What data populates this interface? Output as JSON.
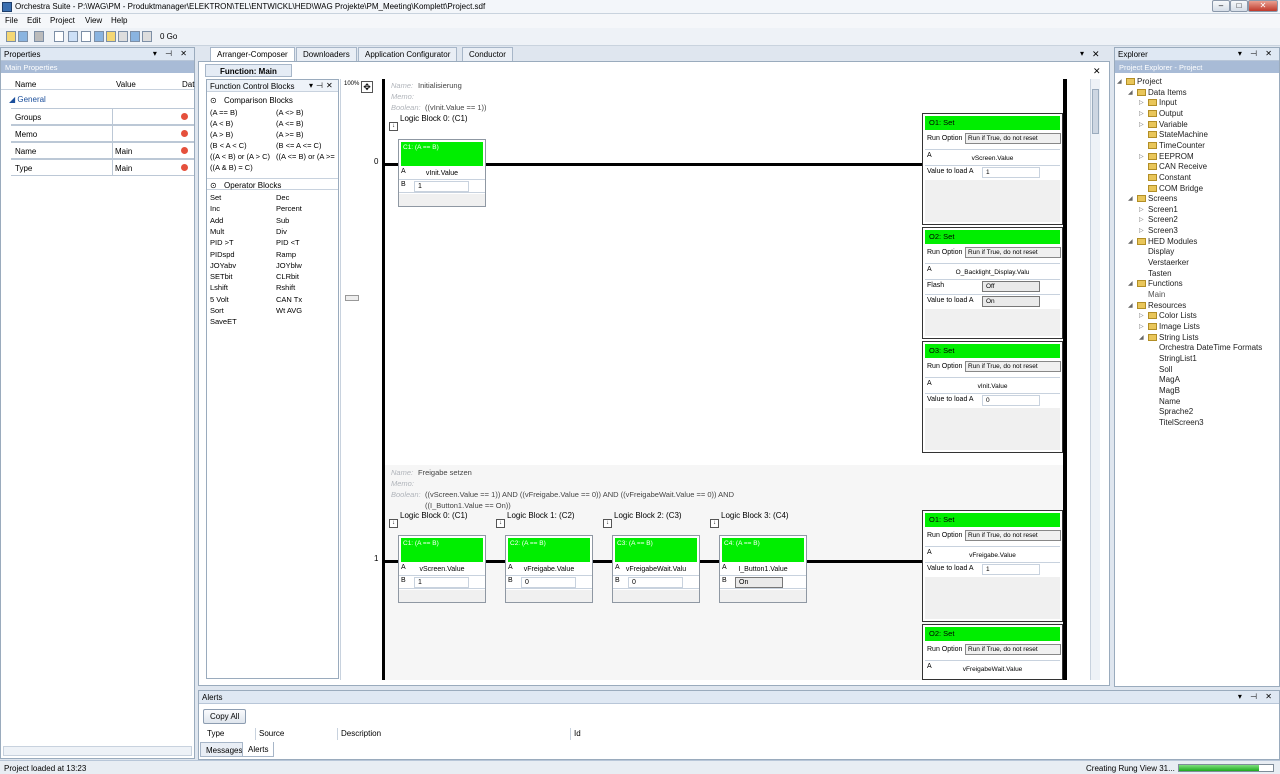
{
  "window": {
    "title": "Orchestra Suite - P:\\WAG\\PM - Produktmanager\\ELEKTRON\\TEL\\ENTWICKL\\HED\\WAG Projekte\\PM_Meeting\\Komplett\\Project.sdf",
    "min": "–",
    "max": "□",
    "close": "✕"
  },
  "menu": [
    "File",
    "Edit",
    "Project",
    "View",
    "Help"
  ],
  "toolbar": {
    "go_label": "0 Go"
  },
  "properties": {
    "title": "Properties",
    "subtitle": "Main Properties",
    "col_name": "Name",
    "col_value": "Value",
    "col_data": "Dat",
    "group": "General",
    "rows": [
      {
        "name": "Groups",
        "value": ""
      },
      {
        "name": "Memo",
        "value": ""
      },
      {
        "name": "Name",
        "value": "Main"
      },
      {
        "name": "Type",
        "value": "Main"
      }
    ]
  },
  "doc_tabs": [
    "Arranger-Composer",
    "Downloaders",
    "Application Configurator",
    "Conductor"
  ],
  "function_tab": "Function: Main",
  "zoom": "100%",
  "blocks_panel": {
    "title": "Function Control Blocks",
    "comparison_title": "Comparison Blocks",
    "comparison": [
      [
        "(A == B)",
        "(A <> B)"
      ],
      [
        "(A < B)",
        "(A <= B)"
      ],
      [
        "(A > B)",
        "(A >= B)"
      ],
      [
        "(B < A < C)",
        "(B <= A <= C)"
      ],
      [
        "((A < B) or (A > C)",
        "((A <= B) or (A >="
      ],
      [
        "((A & B) = C)",
        ""
      ]
    ],
    "operator_title": "Operator Blocks",
    "operators": [
      [
        "Set",
        "Dec"
      ],
      [
        "Inc",
        "Percent"
      ],
      [
        "Add",
        "Sub"
      ],
      [
        "Mult",
        "Div"
      ],
      [
        "PID >T",
        "PID <T"
      ],
      [
        "PIDspd",
        "Ramp"
      ],
      [
        "JOYabv",
        "JOYblw"
      ],
      [
        "SETbit",
        "CLRbit"
      ],
      [
        "Lshift",
        "Rshift"
      ],
      [
        "5 Volt",
        "CAN Tx"
      ],
      [
        "Sort",
        "Wt AVG"
      ],
      [
        "SaveET",
        ""
      ]
    ]
  },
  "rung0": {
    "number": "0",
    "name_label": "Name:",
    "name": "Initialisierung",
    "memo_label": "Memo:",
    "bool_label": "Boolean:",
    "bool": "((vInit.Value == 1))",
    "logic_title": "Logic Block 0: (C1)",
    "cblock": {
      "hdr": "C1: (A == B)",
      "a_val": "vInit.Value",
      "b_val": "1"
    },
    "actions": [
      {
        "hdr": "O1: Set",
        "run_label": "Run Option",
        "run": "Run if True, do not reset",
        "a_val": "vScreen.Value",
        "load_label": "Value to load A",
        "load": "1"
      },
      {
        "hdr": "O2: Set",
        "run_label": "Run Option",
        "run": "Run if True, do not reset",
        "a_val": "O_Backlight_Display.Valu",
        "flash_label": "Flash",
        "flash": "Off",
        "load_label": "Value to load A",
        "load": "On"
      },
      {
        "hdr": "O3: Set",
        "run_label": "Run Option",
        "run": "Run if True, do not reset",
        "a_val": "vInit.Value",
        "load_label": "Value to load A",
        "load": "0"
      }
    ]
  },
  "rung1": {
    "number": "1",
    "name_label": "Name:",
    "name": "Freigabe setzen",
    "memo_label": "Memo:",
    "bool_label": "Boolean:",
    "bool": "((vScreen.Value == 1)) AND ((vFreigabe.Value == 0)) AND ((vFreigabeWait.Value == 0)) AND",
    "bool2": "((I_Button1.Value == On))",
    "logic_blocks": [
      {
        "title": "Logic Block 0: (C1)",
        "hdr": "C1: (A == B)",
        "a_val": "vScreen.Value",
        "b_val": "1"
      },
      {
        "title": "Logic Block 1: (C2)",
        "hdr": "C2: (A == B)",
        "a_val": "vFreigabe.Value",
        "b_val": "0"
      },
      {
        "title": "Logic Block 2: (C3)",
        "hdr": "C3: (A == B)",
        "a_val": "vFreigabeWait.Valu",
        "b_val": "0"
      },
      {
        "title": "Logic Block 3: (C4)",
        "hdr": "C4: (A == B)",
        "a_val": "I_Button1.Value",
        "b_val": "On"
      }
    ],
    "actions": [
      {
        "hdr": "O1: Set",
        "run_label": "Run Option",
        "run": "Run if True, do not reset",
        "a_val": "vFreigabe.Value",
        "load_label": "Value to load A",
        "load": "1"
      },
      {
        "hdr": "O2: Set",
        "run_label": "Run Option",
        "run": "Run if True, do not reset",
        "a_val": "vFreigabeWait.Value"
      }
    ]
  },
  "explorer": {
    "title": "Explorer",
    "subtitle": "Project Explorer - Project",
    "tree": [
      {
        "label": "Project",
        "depth": 0,
        "folder": true,
        "arrow": "◢"
      },
      {
        "label": "Data Items",
        "depth": 1,
        "folder": true,
        "arrow": "◢"
      },
      {
        "label": "Input",
        "depth": 2,
        "folder": true,
        "arrow": "▷"
      },
      {
        "label": "Output",
        "depth": 2,
        "folder": true,
        "arrow": "▷"
      },
      {
        "label": "Variable",
        "depth": 2,
        "folder": true,
        "arrow": "▷"
      },
      {
        "label": "StateMachine",
        "depth": 2,
        "folder": true,
        "arrow": ""
      },
      {
        "label": "TimeCounter",
        "depth": 2,
        "folder": true,
        "arrow": ""
      },
      {
        "label": "EEPROM",
        "depth": 2,
        "folder": true,
        "arrow": "▷"
      },
      {
        "label": "CAN Receive",
        "depth": 2,
        "folder": true,
        "arrow": ""
      },
      {
        "label": "Constant",
        "depth": 2,
        "folder": true,
        "arrow": ""
      },
      {
        "label": "COM Bridge",
        "depth": 2,
        "folder": true,
        "arrow": ""
      },
      {
        "label": "Screens",
        "depth": 1,
        "folder": true,
        "arrow": "◢"
      },
      {
        "label": "Screen1",
        "depth": 2,
        "folder": false,
        "arrow": "▷"
      },
      {
        "label": "Screen2",
        "depth": 2,
        "folder": false,
        "arrow": "▷"
      },
      {
        "label": "Screen3",
        "depth": 2,
        "folder": false,
        "arrow": "▷"
      },
      {
        "label": "HED Modules",
        "depth": 1,
        "folder": true,
        "arrow": "◢"
      },
      {
        "label": "Display",
        "depth": 2,
        "folder": false,
        "arrow": ""
      },
      {
        "label": "Verstaerker",
        "depth": 2,
        "folder": false,
        "arrow": ""
      },
      {
        "label": "Tasten",
        "depth": 2,
        "folder": false,
        "arrow": ""
      },
      {
        "label": "Functions",
        "depth": 1,
        "folder": true,
        "arrow": "◢"
      },
      {
        "label": "Main",
        "depth": 2,
        "folder": false,
        "arrow": "",
        "dim": true
      },
      {
        "label": "Resources",
        "depth": 1,
        "folder": true,
        "arrow": "◢"
      },
      {
        "label": "Color Lists",
        "depth": 2,
        "folder": true,
        "arrow": "▷"
      },
      {
        "label": "Image Lists",
        "depth": 2,
        "folder": true,
        "arrow": "▷"
      },
      {
        "label": "String Lists",
        "depth": 2,
        "folder": true,
        "arrow": "◢"
      },
      {
        "label": "Orchestra DateTime Formats",
        "depth": 3,
        "folder": false,
        "arrow": ""
      },
      {
        "label": "StringList1",
        "depth": 3,
        "folder": false,
        "arrow": ""
      },
      {
        "label": "Soll",
        "depth": 3,
        "folder": false,
        "arrow": ""
      },
      {
        "label": "MagA",
        "depth": 3,
        "folder": false,
        "arrow": ""
      },
      {
        "label": "MagB",
        "depth": 3,
        "folder": false,
        "arrow": ""
      },
      {
        "label": "Name",
        "depth": 3,
        "folder": false,
        "arrow": ""
      },
      {
        "label": "Sprache2",
        "depth": 3,
        "folder": false,
        "arrow": ""
      },
      {
        "label": "TitelScreen3",
        "depth": 3,
        "folder": false,
        "arrow": ""
      }
    ]
  },
  "alerts": {
    "title": "Alerts",
    "copy_all": "Copy All",
    "cols": [
      "Type",
      "Source",
      "Description",
      "Id"
    ]
  },
  "bottom_tabs": [
    "Messages",
    "Alerts"
  ],
  "status": {
    "left": "Project loaded at 13:23",
    "right": "Creating Rung View 31...",
    "progress": 0.85
  }
}
